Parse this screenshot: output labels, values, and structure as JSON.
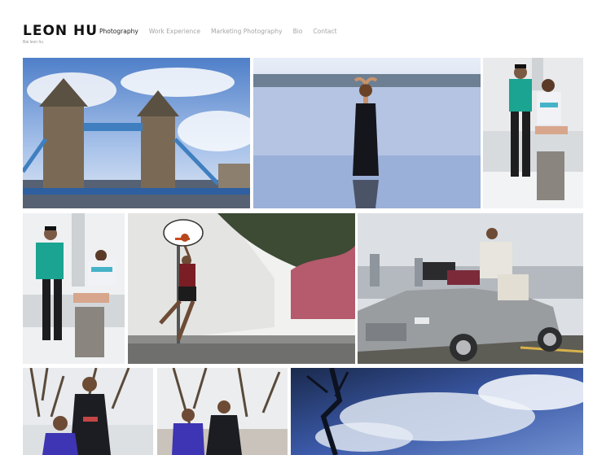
{
  "site": {
    "title": "LEON HU",
    "tagline": "Bai leon hu"
  },
  "nav": {
    "items": [
      {
        "label": "Photography",
        "active": true
      },
      {
        "label": "Work Experience",
        "active": false
      },
      {
        "label": "Marketing Photography",
        "active": false
      },
      {
        "label": "Bio",
        "active": false
      },
      {
        "label": "Contact",
        "active": false
      }
    ]
  },
  "gallery": {
    "photos": [
      {
        "subject": "Tower Bridge London"
      },
      {
        "subject": "Woman in black dress standing in water"
      },
      {
        "subject": "Couple posing with teal jersey"
      },
      {
        "subject": "Couple sitting on pillar"
      },
      {
        "subject": "Basketball player dunking"
      },
      {
        "subject": "Group on silver Mercedes"
      },
      {
        "subject": "Two men under bare trees"
      },
      {
        "subject": "Men posing by trees"
      },
      {
        "subject": "Sky reflection in water"
      }
    ]
  }
}
